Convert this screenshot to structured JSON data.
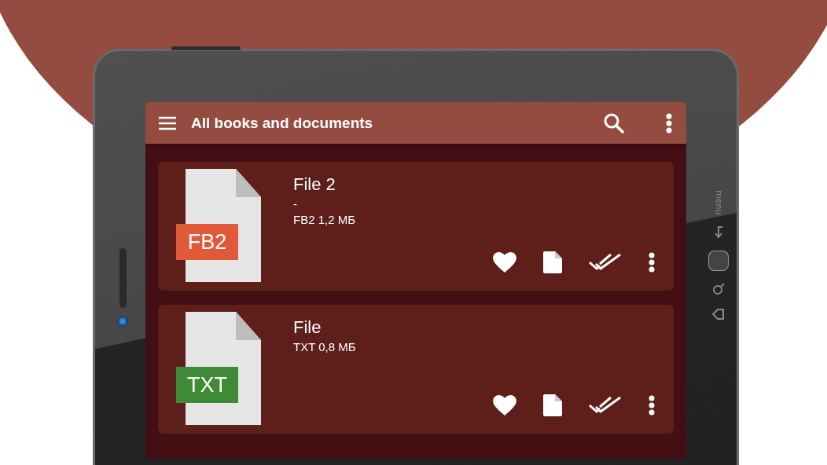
{
  "device": {
    "side_label": "menu"
  },
  "app_bar": {
    "title": "All books and documents"
  },
  "files": [
    {
      "name": "File 2",
      "author": "-",
      "meta": "FB2 1,2 МБ",
      "format": "FB2",
      "color": "#e05a3a"
    },
    {
      "name": "File",
      "meta": "TXT 0,8 МБ",
      "format": "TXT",
      "color": "#3f8a36"
    }
  ]
}
